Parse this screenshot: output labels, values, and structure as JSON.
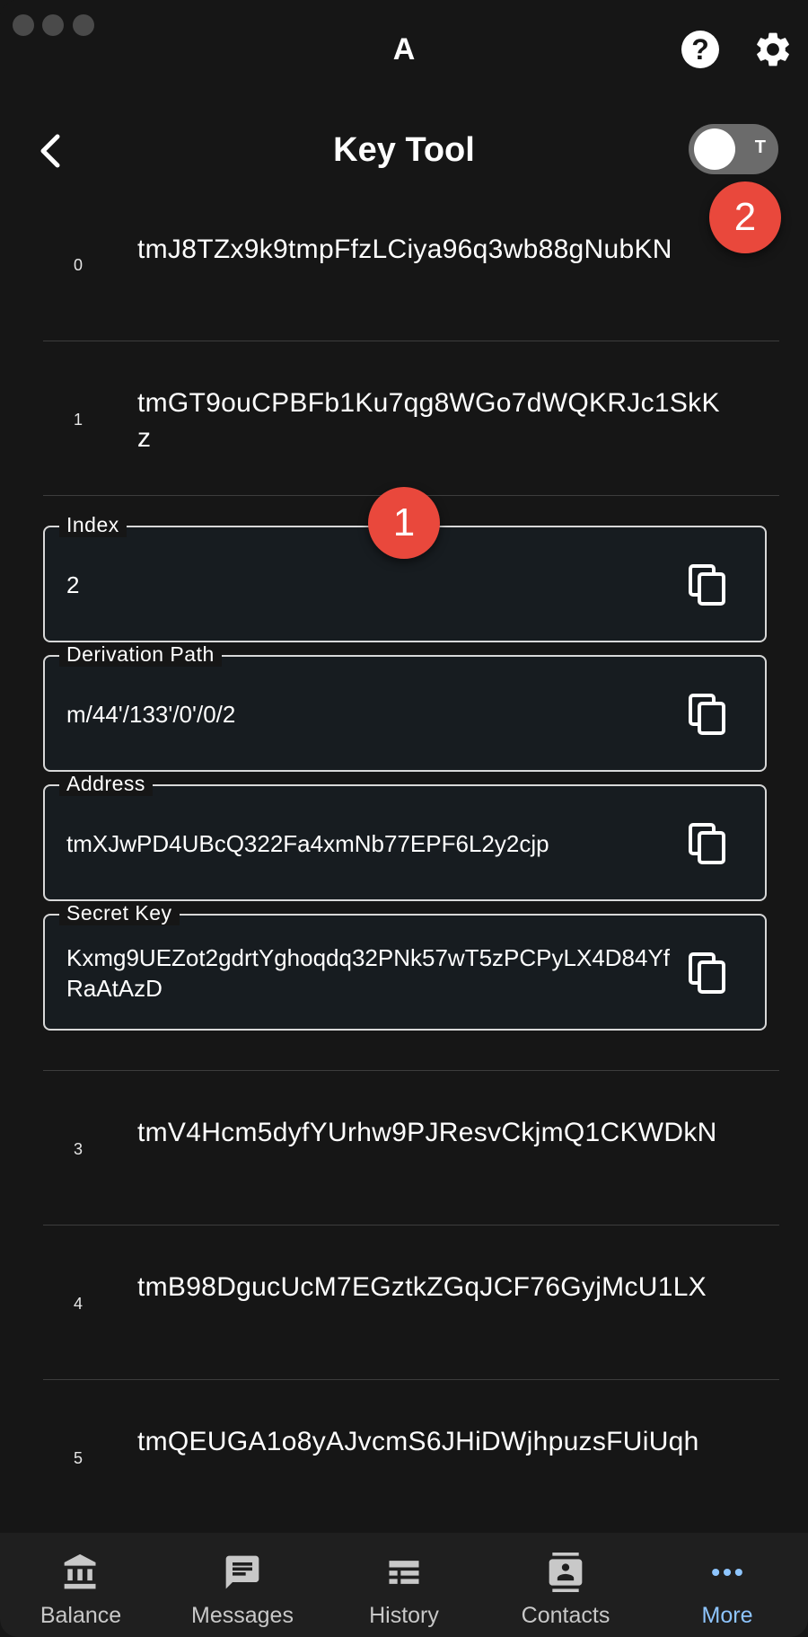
{
  "window": {
    "app_title": "A"
  },
  "header": {
    "title": "Key Tool",
    "toggle_letter": "T"
  },
  "badges": [
    "1",
    "2"
  ],
  "list": {
    "rows_before": [
      {
        "index": "0",
        "address": "tmJ8TZx9k9tmpFfzLCiya96q3wb88gNubKN"
      },
      {
        "index": "1",
        "address": "tmGT9ouCPBFb1Ku7qg8WGo7dWQKRJc1SkKz"
      }
    ],
    "expanded": {
      "index_label": "Index",
      "index_value": "2",
      "path_label": "Derivation Path",
      "path_value": "m/44'/133'/0'/0/2",
      "address_label": "Address",
      "address_value": "tmXJwPD4UBcQ322Fa4xmNb77EPF6L2y2cjp",
      "secret_label": "Secret Key",
      "secret_value": "Kxmg9UEZot2gdrtYghoqdq32PNk57wT5zPCPyLX4D84YfRaAtAzD"
    },
    "rows_after": [
      {
        "index": "3",
        "address": "tmV4Hcm5dyfYUrhw9PJResvCkjmQ1CKWDkN"
      },
      {
        "index": "4",
        "address": "tmB98DgucUcM7EGztkZGqJCF76GyjMcU1LX"
      },
      {
        "index": "5",
        "address": "tmQEUGA1o8yAJvcmS6JHiDWjhpuzsFUiUqh"
      }
    ]
  },
  "bottom_nav": {
    "items": [
      {
        "label": "Balance",
        "icon": "bank-icon"
      },
      {
        "label": "Messages",
        "icon": "message-icon"
      },
      {
        "label": "History",
        "icon": "table-icon"
      },
      {
        "label": "Contacts",
        "icon": "contact-icon"
      },
      {
        "label": "More",
        "icon": "more-icon"
      }
    ],
    "active": "More",
    "active_color": "#8ec5ff"
  },
  "colors": {
    "badge": "#e9483c",
    "background": "#161616",
    "field_background": "#171c20"
  }
}
